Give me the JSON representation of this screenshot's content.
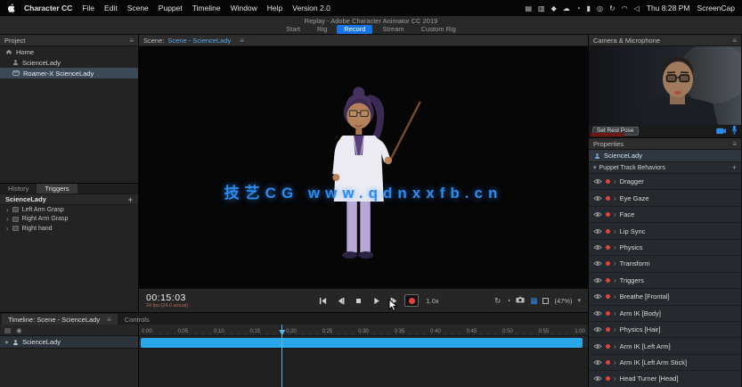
{
  "menubar": {
    "items": [
      "Character CC",
      "File",
      "Edit",
      "Scene",
      "Puppet",
      "Timeline",
      "Window",
      "Help",
      "Version 2.0"
    ],
    "status_icons": [
      {
        "name": "keystrokes-icon",
        "glyph": "▤"
      },
      {
        "name": "display-icon",
        "glyph": "▥"
      },
      {
        "name": "dropbox-icon",
        "glyph": "◆"
      },
      {
        "name": "cloud-icon",
        "glyph": "☁"
      },
      {
        "name": "stats-icon",
        "glyph": "◔"
      },
      {
        "name": "battery-icon",
        "glyph": "▮"
      },
      {
        "name": "spotlight-icon",
        "glyph": "◎"
      },
      {
        "name": "sync-icon",
        "glyph": "↻"
      },
      {
        "name": "wifi-icon",
        "glyph": "◠"
      },
      {
        "name": "volume-icon",
        "glyph": "◁"
      }
    ],
    "clock": "Thu 8:28 PM",
    "screencap": "ScreenCap"
  },
  "titlebar": {
    "title": "Replay - Adobe Character Animator CC 2019",
    "tabs": [
      {
        "label": "Start",
        "active": false
      },
      {
        "label": "Rig",
        "active": false
      },
      {
        "label": "Record",
        "active": true
      },
      {
        "label": "Stream",
        "active": false
      },
      {
        "label": "Custom Rig",
        "active": false
      }
    ]
  },
  "project_panel": {
    "title": "Project",
    "items": [
      {
        "label": "Home"
      },
      {
        "label": "ScienceLady"
      },
      {
        "label": "Roamer-X ScienceLady"
      }
    ]
  },
  "triggers_panel": {
    "tabs": [
      {
        "label": "History",
        "active": false
      },
      {
        "label": "Triggers",
        "active": true
      }
    ],
    "group": "ScienceLady",
    "add_label": "+",
    "rows": [
      "Left Arm Grasp",
      "Right Arm Grasp",
      "Right hand"
    ]
  },
  "scene_panel": {
    "header_prefix": "Scene:",
    "header_title": "Scene - ScienceLady",
    "watermark": "技艺CG  www.qdnxxfb.cn"
  },
  "transport": {
    "timecode": "00:15:03",
    "fps": "24 fps (24.0 actual)",
    "speed": "1.0x",
    "zoom": "(47%)",
    "zoom_caret": "▾"
  },
  "timeline": {
    "tab_main": "Timeline: Scene - ScienceLady",
    "tab_controls": "Controls",
    "track": "ScienceLady",
    "ticks": [
      "0:00",
      "0:05",
      "0:10",
      "0:15",
      "0:20",
      "0:25",
      "0:30",
      "0:35",
      "0:40",
      "0:45",
      "0:50",
      "0:55",
      "1:00"
    ]
  },
  "camera_panel": {
    "title": "Camera & Microphone",
    "rest_pose": "Set Rest Pose"
  },
  "properties_panel": {
    "title": "Properties",
    "puppet": "ScienceLady",
    "section": "Puppet Track Behaviors",
    "behaviors": [
      "Dragger",
      "Eye Gaze",
      "Face",
      "Lip Sync",
      "Physics",
      "Transform",
      "Triggers",
      "Breathe [Frontal]",
      "Arm IK [Body]",
      "Physics [Hair]",
      "Arm IK [Left Arm]",
      "Arm IK [Left Arm Stick]",
      "Head Turner [Head]"
    ]
  }
}
